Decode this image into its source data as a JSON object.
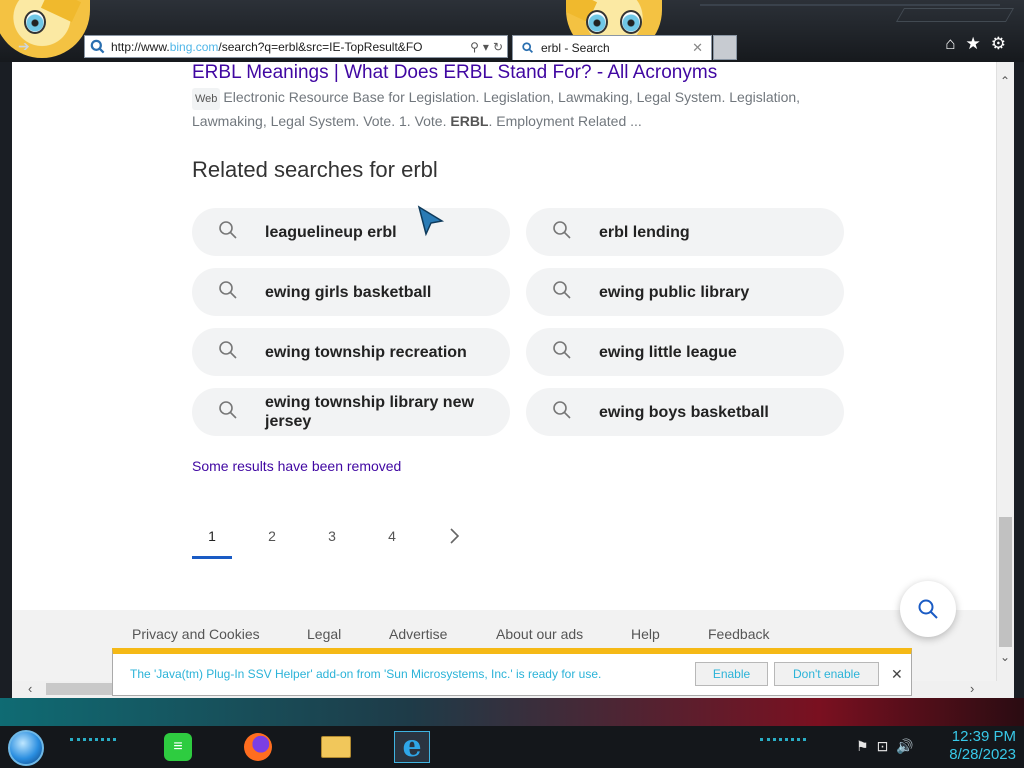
{
  "browser": {
    "address_url": "http://www.bing.com/search?q=erbl&src=IE-TopResult&FO",
    "address_prefix": "http://www.",
    "address_host": "bing.com",
    "address_path": "/search?q=erbl&src=IE-TopResult&FO",
    "tab_title": "erbl - Search"
  },
  "result": {
    "title": "ERBL Meanings | What Does ERBL Stand For? - All Acronyms",
    "badge": "Web",
    "snippet_text": "Electronic Resource Base for Legislation. Legislation, Lawmaking, Legal System. Legislation, Lawmaking, Legal System. Vote. 1. Vote. ",
    "snippet_bold": "ERBL",
    "snippet_tail": ". Employment Related ..."
  },
  "related": {
    "heading": "Related searches for erbl",
    "items": [
      "leaguelineup erbl",
      "erbl lending",
      "ewing girls basketball",
      "ewing public library",
      "ewing township recreation",
      "ewing little league",
      "ewing township library new jersey",
      "ewing boys basketball"
    ]
  },
  "removed_notice": "Some results have been removed",
  "pagination": {
    "pages": [
      "1",
      "2",
      "3",
      "4"
    ],
    "current": "1"
  },
  "footer": {
    "links": [
      "Privacy and Cookies",
      "Legal",
      "Advertise",
      "About our ads",
      "Help",
      "Feedback"
    ]
  },
  "notification": {
    "message": "The 'Java(tm) Plug-In SSV Helper' add-on from 'Sun Microsystems, Inc.' is ready for use.",
    "enable_label": "Enable",
    "dont_enable_label": "Don't enable"
  },
  "taskbar": {
    "time": "12:39 PM",
    "date": "8/28/2023"
  },
  "colors": {
    "link_purple": "#4007a2",
    "pagination_accent": "#1a5bc4",
    "notify_text": "#2bb3d8",
    "notify_border": "#f5b916",
    "clock": "#38c9e8"
  }
}
